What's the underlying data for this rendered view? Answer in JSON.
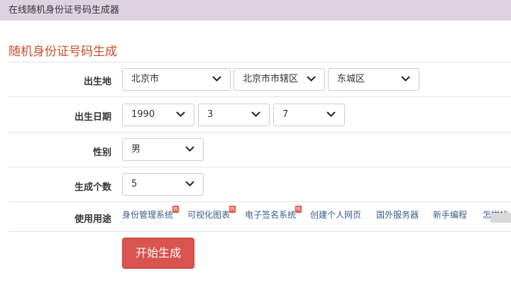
{
  "header": {
    "title": "在线随机身份证号码生成器"
  },
  "page": {
    "title": "随机身份证号码生成"
  },
  "form": {
    "birthplace": {
      "label": "出生地",
      "province": "北京市",
      "city": "北京市市辖区",
      "district": "东城区"
    },
    "birthdate": {
      "label": "出生日期",
      "year": "1990",
      "month": "3",
      "day": "7"
    },
    "gender": {
      "label": "性别",
      "value": "男"
    },
    "count": {
      "label": "生成个数",
      "value": "5"
    },
    "usage": {
      "label": "使用用途",
      "links": [
        {
          "text": "身份管理系统",
          "hot": "热"
        },
        {
          "text": "可视化图表",
          "hot": "热"
        },
        {
          "text": "电子签名系统",
          "hot": "热"
        },
        {
          "text": "创建个人网页"
        },
        {
          "text": "国外服务器"
        },
        {
          "text": "新手编程"
        },
        {
          "text": "怎样找"
        }
      ]
    },
    "submit_label": "开始生成"
  }
}
